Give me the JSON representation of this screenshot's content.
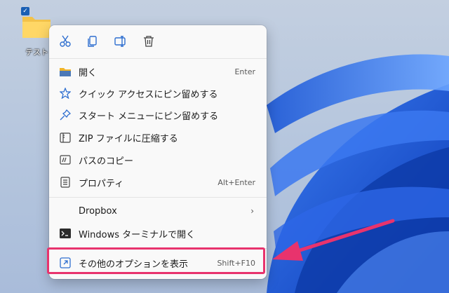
{
  "desktop": {
    "icon_label": "テスト",
    "accent": "#1a5fb4"
  },
  "toolbar": {
    "buttons": [
      "cut-icon",
      "copy-icon",
      "rename-icon",
      "delete-icon"
    ]
  },
  "menu": {
    "items": [
      {
        "label": "開く",
        "shortcut": "Enter",
        "icon": "folder-open-icon"
      },
      {
        "label": "クイック アクセスにピン留めする",
        "shortcut": "",
        "icon": "star-icon"
      },
      {
        "label": "スタート メニューにピン留めする",
        "shortcut": "",
        "icon": "pin-icon"
      },
      {
        "label": "ZIP ファイルに圧縮する",
        "shortcut": "",
        "icon": "zip-icon"
      },
      {
        "label": "パスのコピー",
        "shortcut": "",
        "icon": "path-copy-icon"
      },
      {
        "label": "プロパティ",
        "shortcut": "Alt+Enter",
        "icon": "properties-icon"
      },
      {
        "label": "Dropbox",
        "shortcut": "",
        "icon": ""
      },
      {
        "label": "Windows ターミナルで開く",
        "shortcut": "",
        "icon": "terminal-icon"
      },
      {
        "label": "その他のオプションを表示",
        "shortcut": "Shift+F10",
        "icon": "more-options-icon"
      }
    ],
    "submenu_arrow": "›"
  },
  "annotation": {
    "highlight_color": "#e8336d"
  }
}
